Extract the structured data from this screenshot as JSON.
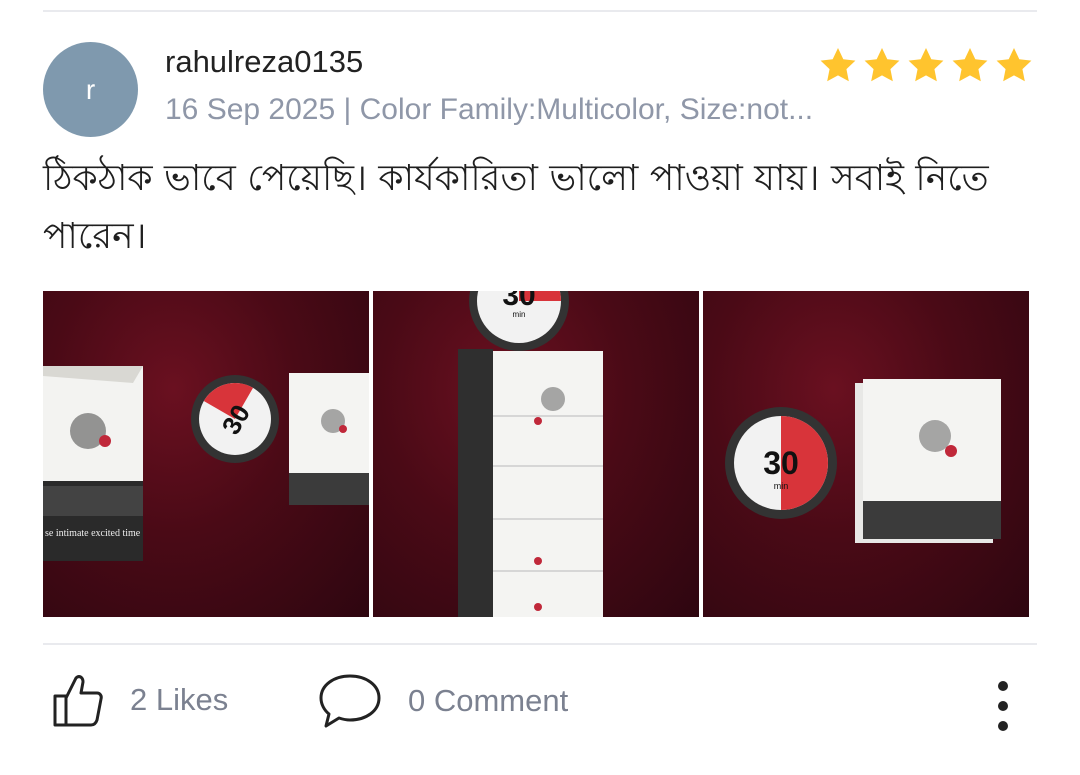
{
  "review": {
    "avatar_letter": "r",
    "username": "rahulreza0135",
    "meta": "16 Sep 2025 | Color Family:Multicolor, Size:not...",
    "rating": 5,
    "text": "ঠিকঠাক ভাবে পেয়েছি। কার্যকারিতা ভালো পাওয়া যায়। সবাই নিতে পারেন।",
    "photos": [
      {
        "timer_number": "30",
        "timer_unit": "min",
        "box_caption": "se intimate excited time"
      },
      {
        "timer_number": "30",
        "timer_unit": "min"
      },
      {
        "timer_number": "30",
        "timer_unit": "min"
      }
    ]
  },
  "actions": {
    "likes_label": "2 Likes",
    "comment_label": "0 Comment"
  },
  "colors": {
    "avatar": "#7f99ae",
    "star": "#ffc42e",
    "muted_text": "#8f97a8",
    "divider": "#e9eaee"
  }
}
